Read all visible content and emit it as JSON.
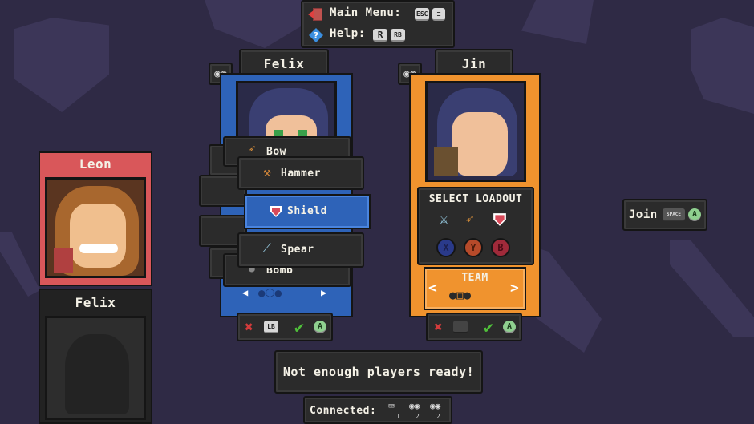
{
  "top_menu": {
    "main_menu_label": "Main Menu:",
    "main_menu_key": "ESC",
    "help_label": "Help:",
    "help_key_1": "R",
    "help_key_2": "RB"
  },
  "players": {
    "leon": {
      "name": "Leon",
      "color": "#d9575a"
    },
    "felix_blue": {
      "name": "Felix",
      "slot": "1",
      "color": "#2e63b8"
    },
    "jin": {
      "name": "Jin",
      "slot": "2",
      "color": "#f0932e"
    },
    "felix_empty": {
      "name": "Felix"
    }
  },
  "weapon_menu": {
    "items": [
      {
        "label": "Bow",
        "icon": "bow-icon"
      },
      {
        "label": "Hammer",
        "icon": "hammer-icon"
      },
      {
        "label": "Shield",
        "icon": "shield-icon",
        "selected": true
      },
      {
        "label": "Spear",
        "icon": "spear-icon"
      },
      {
        "label": "Bomb",
        "icon": "bomb-icon"
      }
    ]
  },
  "jin_panel": {
    "loadout_title": "SELECT LOADOUT",
    "btn_x": "X",
    "btn_y": "Y",
    "btn_b": "B",
    "team_label": "TEAM"
  },
  "felix_controls": {
    "cancel_key": "LB",
    "confirm_key": "A"
  },
  "jin_controls": {
    "cancel_key": "",
    "confirm_key": "A"
  },
  "join": {
    "label": "Join",
    "key_space": "SPACE",
    "key_a": "A"
  },
  "status": {
    "message": "Not enough players ready!"
  },
  "connected": {
    "label": "Connected:",
    "slot_1": "1",
    "slot_2": "2",
    "slot_3": "2"
  },
  "colors": {
    "background": "#2f2a45",
    "selected": "#2e63b8",
    "confirm": "#4fbf3a",
    "cancel": "#d23b3b"
  }
}
